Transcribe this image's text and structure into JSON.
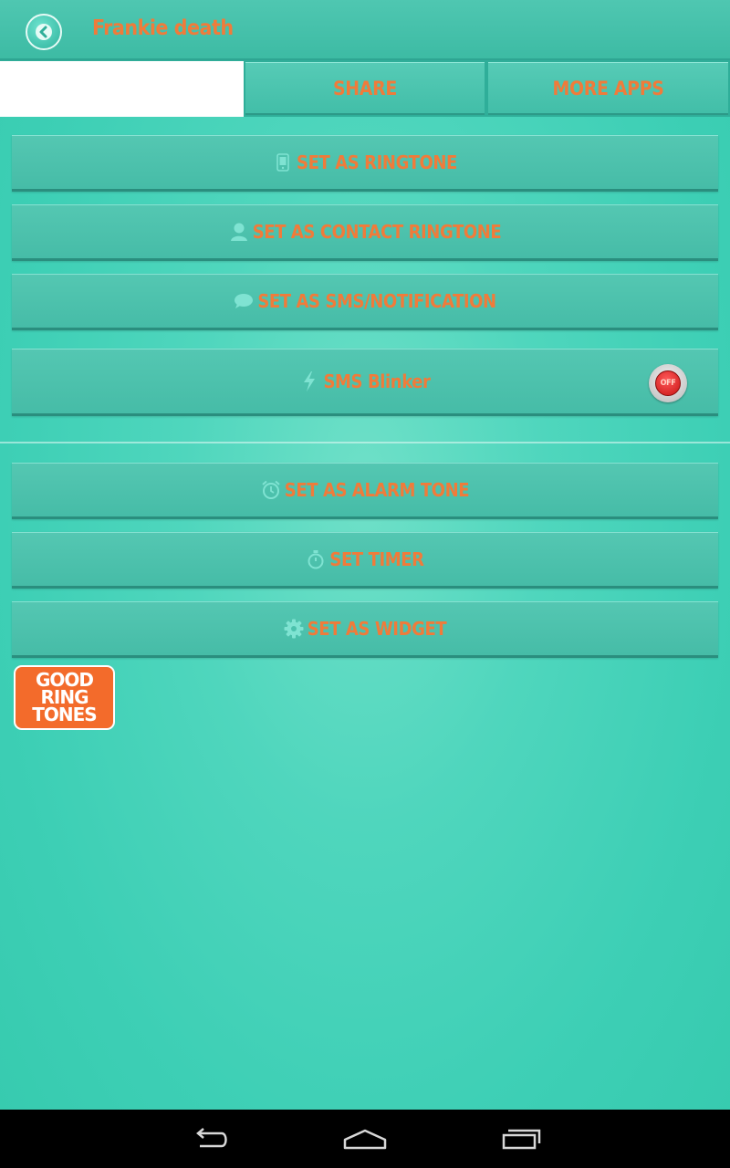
{
  "app": {
    "title": "Frankie death"
  },
  "tabs": {
    "share": "SHARE",
    "more_apps": "MORE APPS"
  },
  "actions": {
    "ringtone": "SET AS RINGTONE",
    "contact_ringtone": "SET AS CONTACT RINGTONE",
    "sms_notification": "SET AS SMS/NOTIFICATION",
    "sms_blinker": "SMS Blinker",
    "sms_blinker_state": "OFF",
    "alarm": "SET AS ALARM TONE",
    "timer": "SET TIMER",
    "widget": "SET AS WIDGET"
  },
  "logo": {
    "line1": "GOOD",
    "line2": "RING",
    "line3": "TONES"
  },
  "icons": {
    "back": "back-arrow-icon",
    "ringtone": "phone-icon",
    "contact": "person-icon",
    "sms": "chat-bubble-icon",
    "blinker": "lightning-icon",
    "alarm": "alarm-clock-icon",
    "timer": "stopwatch-icon",
    "widget": "gear-icon",
    "nav_back": "nav-back-icon",
    "nav_home": "nav-home-icon",
    "nav_recent": "nav-recent-apps-icon"
  },
  "colors": {
    "accent_text": "#f07b3a",
    "background": "#3dcfb5",
    "button": "#4cc2ad",
    "logo": "#f36b2b",
    "toggle_off": "#e02020"
  }
}
